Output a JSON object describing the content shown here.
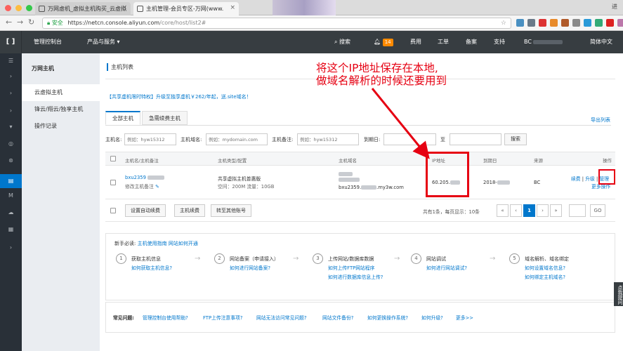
{
  "browser": {
    "tabs": [
      {
        "label": "万网虚机_虚拟主机购买_云虚拟"
      },
      {
        "label": "主机管理-会员专区-万网(www."
      }
    ],
    "user_corner": "进",
    "omnibox": {
      "secure_label": "安全",
      "url_main": "https://netcn.console.aliyun.com",
      "url_path": "/core/host/list2#"
    }
  },
  "topnav": {
    "console": "管理控制台",
    "products": "产品与服务",
    "search": "搜索",
    "notifications": "14",
    "billing": "费用",
    "tickets": "工单",
    "icp": "备案",
    "support": "支持",
    "user_prefix": "BC",
    "language": "简体中文"
  },
  "subside": {
    "title": "万网主机",
    "items": [
      {
        "label": "云虚拟主机"
      },
      {
        "label": "锋云/翔云/独享主机"
      },
      {
        "label": "操作记录"
      }
    ]
  },
  "main": {
    "title": "主机列表",
    "promo": "【共享虚机限时特权】升级至独享虚机￥262/年起，送.site域名！",
    "tabs": [
      {
        "label": "全部主机"
      },
      {
        "label": "急需续费主机"
      }
    ],
    "export": "导出列表",
    "filters": {
      "host_name_label": "主机名:",
      "host_name_ph": "例如：hyw15312",
      "domain_label": "主机域名:",
      "domain_ph": "例如：mydomain.com",
      "note_label": "主机备注:",
      "note_ph": "例如：hyw15312",
      "expire_label": "到期日:",
      "to_label": "至",
      "search_btn": "搜索"
    },
    "table": {
      "headers": [
        "主机名/主机备注",
        "主机类型/配置",
        "主机域名",
        "IP地址",
        "到期日",
        "来源",
        "操作"
      ],
      "row": {
        "host_name": "bxu2359",
        "note_action": "修改主机备注",
        "type": "共享虚拟主机普惠版",
        "config": "空间：200M 流量：10GB",
        "domain": "bxu2359.",
        "domain_suffix": ".my3w.com",
        "ip": "60.205.",
        "expire": "2018-",
        "source": "BC",
        "actions": [
          "续费",
          "升级",
          "管理"
        ],
        "more": "更多操作"
      },
      "footer": {
        "auto_renew": "设置自动续费",
        "renew": "主机续费",
        "transfer": "转至其他账号",
        "page_info": "共有1条，每页显示：10条",
        "pages": [
          "«",
          "‹",
          "1",
          "›",
          "»"
        ],
        "go": "GO"
      }
    },
    "guide": {
      "heading": "新手必读:",
      "heading_links": [
        "主机使用指南",
        "网站如何开通"
      ],
      "steps": [
        {
          "num": "1",
          "title": "获取主机信息",
          "links": [
            "如何获取主机信息?"
          ]
        },
        {
          "num": "2",
          "title": "网站备案（申请接入）",
          "links": [
            "如何进行网站备案?"
          ]
        },
        {
          "num": "3",
          "title": "上传网站/数据库数据",
          "links": [
            "如何上传FTP网站程序",
            "如何进行数据库信息上传?"
          ]
        },
        {
          "num": "4",
          "title": "网站调试",
          "links": [
            "如何进行网站调试?"
          ]
        },
        {
          "num": "5",
          "title": "域名解析、域名绑定",
          "links": [
            "如何设置域名信息?",
            "如何绑定主机域名?"
          ]
        }
      ]
    },
    "faq": {
      "label": "常见问题:",
      "links": [
        "管理控制台使用帮助?",
        "FTP上传注意事项?",
        "网站无法访问常见问题?",
        "网站文件备份?",
        "如何更换操作系统?",
        "如何升级?",
        "更多>>"
      ]
    }
  },
  "float_side": "点我提问",
  "annotation": {
    "line1": "将这个IP地址保存在本地,",
    "line2": "做域名解析的时候还要用到",
    "color": "#e60012"
  }
}
